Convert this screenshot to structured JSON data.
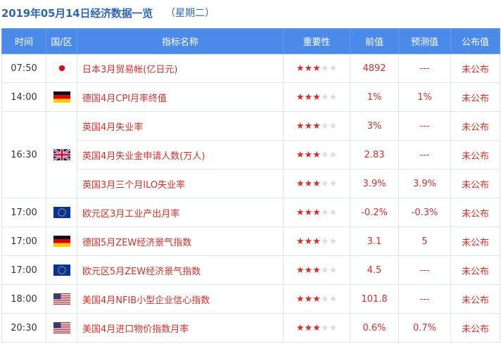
{
  "header": {
    "title": "2019年05月14日经济数据一览",
    "weekday": "（星期二）"
  },
  "table": {
    "columns": [
      "时间",
      "国/区",
      "指标名称",
      "重要性",
      "前值",
      "预测值",
      "公布值"
    ],
    "groups": [
      {
        "time": "07:50",
        "flag": "japan-flag",
        "rows": [
          {
            "indicator": "日本3月贸易帐(亿日元)",
            "importance": 3,
            "previous": "4892",
            "forecast": "---",
            "actual": "未公布"
          }
        ]
      },
      {
        "time": "14:00",
        "flag": "germany-flag",
        "rows": [
          {
            "indicator": "德国4月CPI月率终值",
            "importance": 3,
            "previous": "1%",
            "forecast": "1%",
            "actual": "未公布"
          }
        ]
      },
      {
        "time": "16:30",
        "flag": "uk-flag",
        "rows": [
          {
            "indicator": "英国4月失业率",
            "importance": 3,
            "previous": "3%",
            "forecast": "---",
            "actual": "未公布"
          },
          {
            "indicator": "英国4月失业金申请人数(万人)",
            "importance": 3,
            "previous": "2.83",
            "forecast": "---",
            "actual": "未公布"
          },
          {
            "indicator": "英国3月三个月ILO失业率",
            "importance": 3,
            "previous": "3.9%",
            "forecast": "3.9%",
            "actual": "未公布"
          }
        ]
      },
      {
        "time": "17:00",
        "flag": "eu-flag",
        "rows": [
          {
            "indicator": "欧元区3月工业产出月率",
            "importance": 3,
            "previous": "-0.2%",
            "forecast": "-0.3%",
            "actual": "未公布"
          }
        ]
      },
      {
        "time": "17:00",
        "flag": "germany-flag",
        "rows": [
          {
            "indicator": "德国5月ZEW经济景气指数",
            "importance": 3,
            "previous": "3.1",
            "forecast": "5",
            "actual": "未公布"
          }
        ]
      },
      {
        "time": "17:00",
        "flag": "eu-flag",
        "rows": [
          {
            "indicator": "欧元区5月ZEW经济景气指数",
            "importance": 3,
            "previous": "4.5",
            "forecast": "---",
            "actual": "未公布"
          }
        ]
      },
      {
        "time": "18:00",
        "flag": "usa-flag",
        "rows": [
          {
            "indicator": "美国4月NFIB小型企业信心指数",
            "importance": 3,
            "previous": "101.8",
            "forecast": "---",
            "actual": "未公布"
          }
        ]
      },
      {
        "time": "20:30",
        "flag": "usa-flag",
        "rows": [
          {
            "indicator": "美国4月进口物价指数月率",
            "importance": 3,
            "previous": "0.6%",
            "forecast": "0.7%",
            "actual": "未公布"
          }
        ]
      }
    ]
  },
  "colors": {
    "title": "#2f66b1",
    "header_bg": "#4b8ae9",
    "accent_red": "#d2302b",
    "star_empty": "#dcdcdc"
  }
}
